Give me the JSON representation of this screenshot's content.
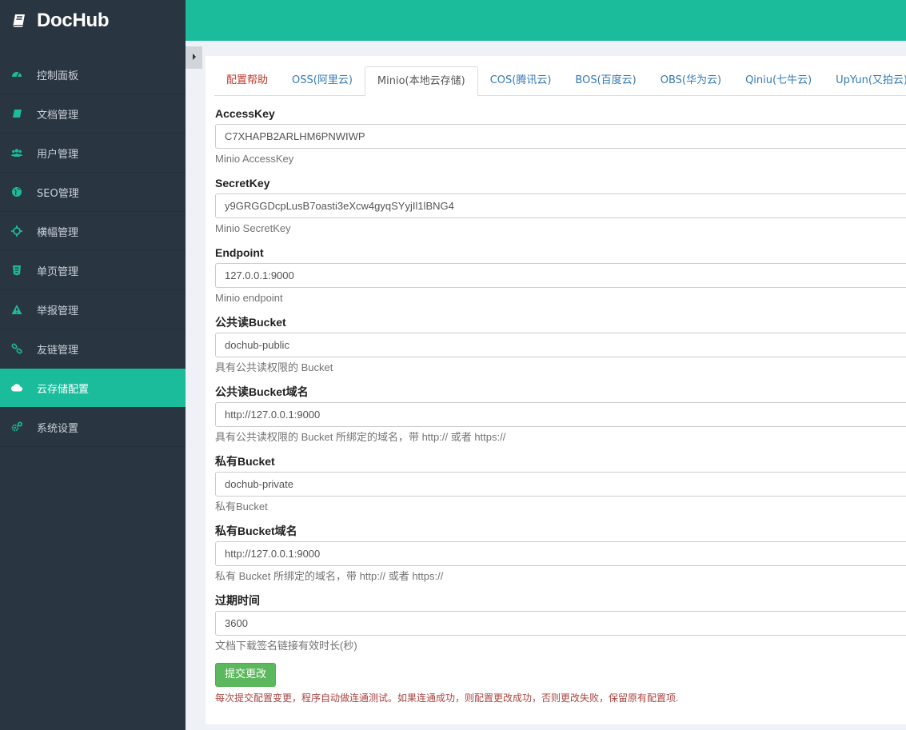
{
  "brand": {
    "name": "DocHub",
    "icon": "book-icon"
  },
  "sidebar": {
    "items": [
      {
        "label": "控制面板",
        "icon": "dashboard-icon"
      },
      {
        "label": "文档管理",
        "icon": "book-icon"
      },
      {
        "label": "用户管理",
        "icon": "users-icon"
      },
      {
        "label": "SEO管理",
        "icon": "globe-icon"
      },
      {
        "label": "横幅管理",
        "icon": "crosshairs-icon"
      },
      {
        "label": "单页管理",
        "icon": "html5-icon"
      },
      {
        "label": "举报管理",
        "icon": "warning-icon"
      },
      {
        "label": "友链管理",
        "icon": "link-icon"
      },
      {
        "label": "云存储配置",
        "icon": "cloud-upload-icon",
        "active": true
      },
      {
        "label": "系统设置",
        "icon": "gears-icon"
      }
    ]
  },
  "tabs": [
    "配置帮助",
    "OSS(阿里云)",
    "Minio(本地云存储)",
    "COS(腾讯云)",
    "BOS(百度云)",
    "OBS(华为云)",
    "Qiniu(七牛云)",
    "UpYun(又拍云)"
  ],
  "active_tab": "Minio(本地云存储)",
  "form": {
    "fields": [
      {
        "label": "AccessKey",
        "value": "C7XHAPB2ARLHM6PNWIWP",
        "help": "Minio AccessKey"
      },
      {
        "label": "SecretKey",
        "value": "y9GRGGDcpLusB7oasti3eXcw4gyqSYyjIl1lBNG4",
        "help": "Minio SecretKey"
      },
      {
        "label": "Endpoint",
        "value": "127.0.0.1:9000",
        "help": "Minio endpoint"
      },
      {
        "label": "公共读Bucket",
        "value": "dochub-public",
        "help": "具有公共读权限的 Bucket"
      },
      {
        "label": "公共读Bucket域名",
        "value": "http://127.0.0.1:9000",
        "help": "具有公共读权限的 Bucket 所绑定的域名，带 http:// 或者 https://"
      },
      {
        "label": "私有Bucket",
        "value": "dochub-private",
        "help": "私有Bucket"
      },
      {
        "label": "私有Bucket域名",
        "value": "http://127.0.0.1:9000",
        "help": "私有 Bucket 所绑定的域名，带 http:// 或者 https://"
      },
      {
        "label": "过期时间",
        "value": "3600",
        "help": "文档下载签名链接有效时长(秒)"
      }
    ],
    "submit_label": "提交更改",
    "note": "每次提交配置变更，程序自动做连通测试。如果连通成功，则配置更改成功，否则更改失败，保留原有配置项."
  },
  "colors": {
    "sidebar_bg": "#2a3542",
    "accent": "#1abc9c",
    "submit": "#5cb85c",
    "warning_text": "#a94442"
  }
}
